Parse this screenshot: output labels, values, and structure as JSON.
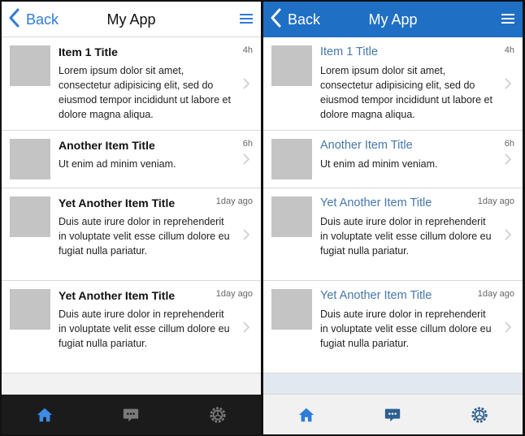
{
  "app": {
    "title": "My App",
    "back_label": "Back"
  },
  "items": [
    {
      "title": "Item 1 Title",
      "body": "Lorem ipsum dolor sit amet, consectetur adipisicing elit, sed do eiusmod tempor incididunt ut labore et dolore magna aliqua.",
      "time": "4h"
    },
    {
      "title": "Another Item Title",
      "body": "Ut enim ad minim veniam.",
      "time": "6h"
    },
    {
      "title": "Yet Another Item Title",
      "body": "Duis aute irure dolor in reprehenderit in voluptate velit esse cillum dolore eu fugiat nulla pariatur.",
      "time": "1day ago"
    },
    {
      "title": "Yet Another Item Title",
      "body": "Duis aute irure dolor in reprehenderit in voluptate velit esse cillum dolore eu fugiat nulla pariatur.",
      "time": "1day ago"
    }
  ],
  "tabs": [
    {
      "icon": "home-icon",
      "active": true
    },
    {
      "icon": "chat-icon",
      "active": false
    },
    {
      "icon": "settings-icon",
      "active": false
    }
  ],
  "colors": {
    "accent": "#2e7cd6",
    "header_blue": "#1f6fc5",
    "title_blue": "#4677a8"
  }
}
